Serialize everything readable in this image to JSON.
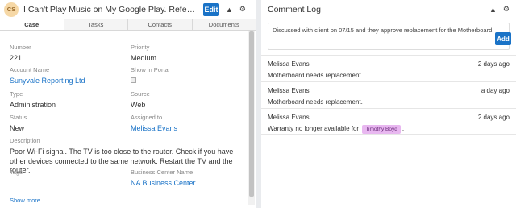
{
  "case": {
    "avatar_initials": "CS",
    "title": "I Can't Play Music on My Google Play. Reference num...",
    "edit_label": "Edit",
    "tabs": [
      "Case",
      "Tasks",
      "Contacts",
      "Documents"
    ],
    "fields": {
      "number_label": "Number",
      "number": "221",
      "priority_label": "Priority",
      "priority": "Medium",
      "account_label": "Account Name",
      "account": "Sunyvale Reporting Ltd",
      "portal_label": "Show in Portal",
      "type_label": "Type",
      "type": "Administration",
      "source_label": "Source",
      "source": "Web",
      "status_label": "Status",
      "status": "New",
      "assigned_label": "Assigned to",
      "assigned": "Melissa Evans",
      "description_label": "Description",
      "description": "Poor Wi-Fi signal. The TV is too close to the router. Check if you have other devices connected to the same network. Restart the TV and the router.",
      "tags_label": "Tags",
      "bc_label": "Business Center Name",
      "bc": "NA Business Center"
    },
    "show_more": "Show more..."
  },
  "comment_log": {
    "title": "Comment Log",
    "compose_text": "Discussed with client on 07/15 and they approve replacement for the Motherboard.",
    "add_label": "Add",
    "entries": [
      {
        "author": "Melissa Evans",
        "time": "2 days ago",
        "message": "Motherboard needs replacement."
      },
      {
        "author": "Melissa Evans",
        "time": "a day ago",
        "message": "Motherboard needs replacement."
      },
      {
        "author": "Melissa Evans",
        "time": "2 days ago",
        "message_pre": "Warranty no longer available for",
        "mention": "Timothy Boyd",
        "message_post": "."
      }
    ]
  },
  "colors": {
    "accent": "#1a73c7",
    "mention_bg": "#e8b7f0",
    "avatar_bg": "#f6d8a6"
  },
  "icons": {
    "collapse": "chevron-up-icon",
    "settings": "gear-icon"
  }
}
